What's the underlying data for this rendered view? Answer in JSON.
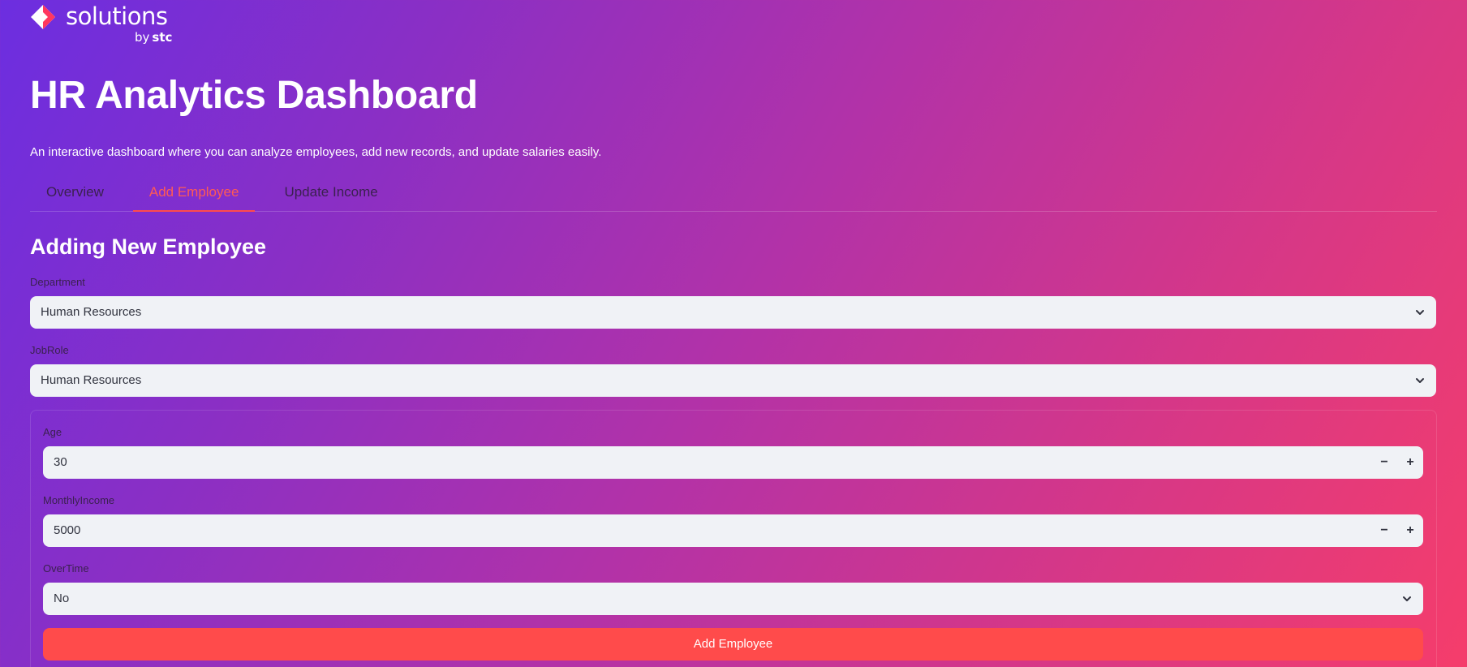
{
  "brand": {
    "logo_text": "solutions",
    "logo_sub_by": "by",
    "logo_sub_brand": "stc"
  },
  "header": {
    "title": "HR Analytics Dashboard",
    "subtitle": "An interactive dashboard where you can analyze employees, add new records, and update salaries easily."
  },
  "tabs": [
    {
      "label": "Overview",
      "active": false
    },
    {
      "label": "Add Employee",
      "active": true
    },
    {
      "label": "Update Income",
      "active": false
    }
  ],
  "section": {
    "title": "Adding New Employee"
  },
  "department": {
    "label": "Department",
    "value": "Human Resources"
  },
  "jobrole": {
    "label": "JobRole",
    "value": "Human Resources"
  },
  "form": {
    "age": {
      "label": "Age",
      "value": "30"
    },
    "monthly_income": {
      "label": "MonthlyIncome",
      "value": "5000"
    },
    "overtime": {
      "label": "OverTime",
      "value": "No"
    },
    "submit_label": "Add Employee"
  },
  "colors": {
    "accent": "#ff4b4b",
    "gradient_start": "#6c2ee0",
    "gradient_end": "#f53d6b",
    "input_bg": "#f0f2f6"
  },
  "icons": {
    "logo": "stc-diamond-logo-icon",
    "select_arrow": "chevron-down-icon",
    "decrement": "minus-icon",
    "increment": "plus-icon"
  }
}
